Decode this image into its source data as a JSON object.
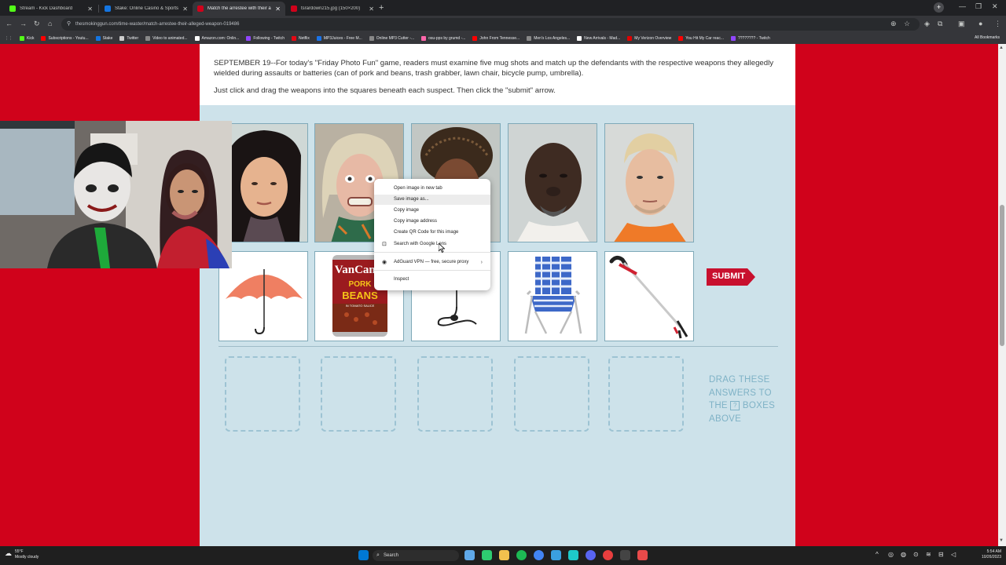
{
  "browser": {
    "tabs": [
      {
        "title": "Stream - Kick Dashboard",
        "fav_color": "#53fc18",
        "active": false
      },
      {
        "title": "Stake: Online Casino & Sports",
        "fav_color": "#1475e1",
        "active": false
      },
      {
        "title": "Match the arrestee with their a",
        "fav_color": "#d0021b",
        "active": true
      },
      {
        "title": "tsrardown215.jpg (150×200)",
        "fav_color": "#d0021b",
        "active": false
      }
    ],
    "url": "thesmokinggun.com/time-waster/match-arrestee-their-alleged-weapon-019486",
    "bookmarks": [
      {
        "label": "Kick",
        "color": "#53fc18"
      },
      {
        "label": "Subscriptions - Youtu...",
        "color": "#ff0000"
      },
      {
        "label": "Stake",
        "color": "#1475e1"
      },
      {
        "label": "Twitter",
        "color": "#cccccc"
      },
      {
        "label": "Video to animated...",
        "color": "#888888"
      },
      {
        "label": "Amazon.com: Onlin...",
        "color": "#ffffff"
      },
      {
        "label": "Following - Twitch",
        "color": "#9146ff"
      },
      {
        "label": "Netflix",
        "color": "#e50914"
      },
      {
        "label": "MP3Juices - Free M...",
        "color": "#1a73e8"
      },
      {
        "label": "Online MP3 Cutter -...",
        "color": "#888888"
      },
      {
        "label": "osu-pps by grumd -...",
        "color": "#ff66aa"
      },
      {
        "label": "John From Tennesse...",
        "color": "#ff0000"
      },
      {
        "label": "Men's Los Angeles...",
        "color": "#888888"
      },
      {
        "label": "New Arrivals - Mad...",
        "color": "#ffffff"
      },
      {
        "label": "My Verizon Overview",
        "color": "#e00000"
      },
      {
        "label": "You Hit My Car reac...",
        "color": "#ff0000"
      },
      {
        "label": "???????? - Twitch",
        "color": "#9146ff"
      }
    ],
    "all_bookmarks": "All Bookmarks"
  },
  "game": {
    "intro": "SEPTEMBER 19--For today's \"Friday Photo Fun\" game, readers must examine five mug shots and match up the defendants with the respective weapons they allegedly wielded during assaults or batteries (can of pork and beans, trash grabber, lawn chair, bicycle pump, umbrella).",
    "instructions": "Just click and drag the weapons into the squares beneath each suspect. Then click the \"submit\" arrow.",
    "submit_label": "SUBMIT",
    "drag_hint_line1": "DRAG THESE",
    "drag_hint_line2": "ANSWERS TO",
    "drag_hint_line3a": "THE",
    "drag_hint_box": "?",
    "drag_hint_line3b": "BOXES",
    "drag_hint_line4": "ABOVE",
    "can_brand": "VanCamp",
    "can_text1": "PORK",
    "can_text2": "BEANS",
    "can_text3": "IN TOMATO SAUCE"
  },
  "context_menu": {
    "items": [
      "Open image in new tab",
      "Save image as...",
      "Copy image",
      "Copy image address",
      "Create QR Code for this image",
      "Search with Google Lens",
      "AdGuard VPN — free, secure proxy",
      "Inspect"
    ]
  },
  "taskbar": {
    "temp": "55°F",
    "weather": "Mostly cloudy",
    "search": "Search",
    "time": "5:54 AM",
    "date": "10/26/2023"
  },
  "colors": {
    "page_bg": "#d0021b",
    "panel_bg": "#cde2ea",
    "submit_red": "#c8102e"
  }
}
